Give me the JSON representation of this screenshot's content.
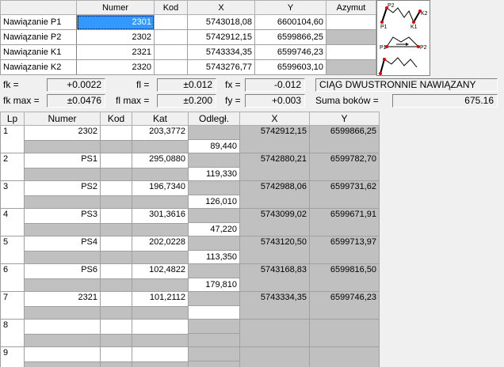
{
  "top_table": {
    "headers": [
      "Numer",
      "Kod",
      "X",
      "Y",
      "Azymut"
    ],
    "rows": [
      {
        "label": "Nawiązanie P1",
        "numer": "2301",
        "kod": "",
        "x": "5743018,08",
        "y": "6600104,60",
        "azymut": ""
      },
      {
        "label": "Nawiązanie P2",
        "numer": "2302",
        "kod": "",
        "x": "5742912,15",
        "y": "6599866,25",
        "azymut": ""
      },
      {
        "label": "Nawiązanie K1",
        "numer": "2321",
        "kod": "",
        "x": "5743334,35",
        "y": "6599746,23",
        "azymut": ""
      },
      {
        "label": "Nawiązanie K2",
        "numer": "2320",
        "kod": "",
        "x": "5743276,77",
        "y": "6599603,10",
        "azymut": ""
      }
    ]
  },
  "diagram": {
    "labels": [
      "P2",
      "K2",
      "P1",
      "K1",
      "P1",
      "P2"
    ]
  },
  "summary": {
    "fk_label": "fk =",
    "fk_value": "+0.0022",
    "fl_label": "fl =",
    "fl_value": "±0.012",
    "fx_label": "fx =",
    "fx_value": "-0.012",
    "status": "CIĄG DWUSTRONNIE NAWIĄZANY",
    "fkmax_label": "fk max =",
    "fkmax_value": "±0.0476",
    "flmax_label": "fl max =",
    "flmax_value": "±0.200",
    "fy_label": "fy =",
    "fy_value": "+0.003",
    "suma_label": "Suma boków =",
    "suma_value": "675.16"
  },
  "main_table": {
    "headers": [
      "Lp",
      "Numer",
      "Kod",
      "Kat",
      "Odległ.",
      "X",
      "Y"
    ],
    "points": [
      {
        "lp": "1",
        "numer": "2302",
        "kod": "",
        "kat": "203,3772",
        "x": "5742912,15",
        "y": "6599866,25",
        "odl": "89,440"
      },
      {
        "lp": "2",
        "numer": "PS1",
        "kod": "",
        "kat": "295,0880",
        "x": "5742880,21",
        "y": "6599782,70",
        "odl": "119,330"
      },
      {
        "lp": "3",
        "numer": "PS2",
        "kod": "",
        "kat": "196,7340",
        "x": "5742988,06",
        "y": "6599731,62",
        "odl": "126,010"
      },
      {
        "lp": "4",
        "numer": "PS3",
        "kod": "",
        "kat": "301,3616",
        "x": "5743099,02",
        "y": "6599671,91",
        "odl": "47,220"
      },
      {
        "lp": "5",
        "numer": "PS4",
        "kod": "",
        "kat": "202,0228",
        "x": "5743120,50",
        "y": "6599713,97",
        "odl": "113,350"
      },
      {
        "lp": "6",
        "numer": "PS6",
        "kod": "",
        "kat": "102,4822",
        "x": "5743168,83",
        "y": "6599816,50",
        "odl": "179,810"
      },
      {
        "lp": "7",
        "numer": "2321",
        "kod": "",
        "kat": "101,2112",
        "x": "5743334,35",
        "y": "6599746,23",
        "odl": ""
      },
      {
        "lp": "8",
        "numer": "",
        "kod": "",
        "kat": "",
        "x": "",
        "y": "",
        "odl": ""
      },
      {
        "lp": "9",
        "numer": "",
        "kod": "",
        "kat": "",
        "x": "",
        "y": "",
        "odl": ""
      }
    ]
  }
}
